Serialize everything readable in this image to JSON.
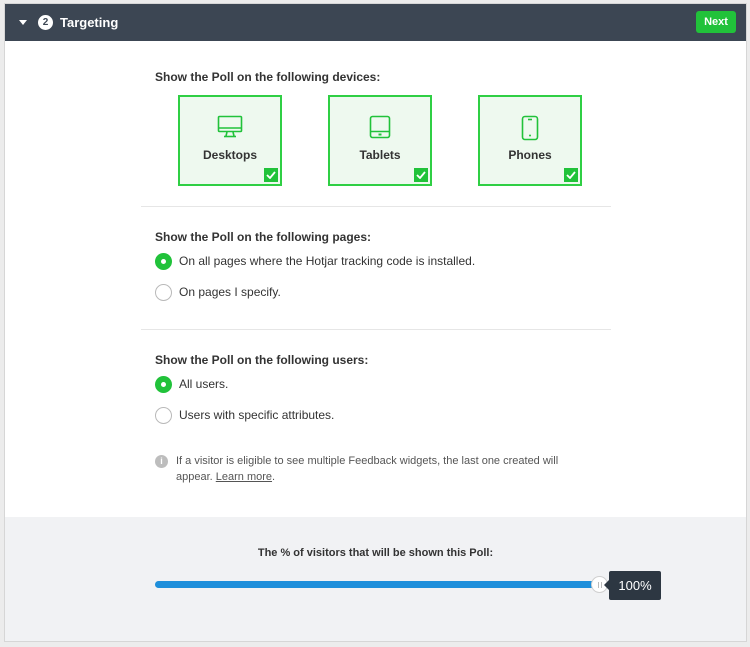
{
  "header": {
    "step_number": "2",
    "title": "Targeting",
    "next_label": "Next"
  },
  "devices": {
    "label": "Show the Poll on the following devices:",
    "items": [
      {
        "label": "Desktops",
        "icon": "desktop-icon",
        "checked": true
      },
      {
        "label": "Tablets",
        "icon": "tablet-icon",
        "checked": true
      },
      {
        "label": "Phones",
        "icon": "phone-icon",
        "checked": true
      }
    ]
  },
  "pages": {
    "label": "Show the Poll on the following pages:",
    "options": [
      {
        "label": "On all pages where the Hotjar tracking code is installed.",
        "checked": true
      },
      {
        "label": "On pages I specify.",
        "checked": false
      }
    ]
  },
  "users": {
    "label": "Show the Poll on the following users:",
    "options": [
      {
        "label": "All users.",
        "checked": true
      },
      {
        "label": "Users with specific attributes.",
        "checked": false
      }
    ]
  },
  "info": {
    "text": "If a visitor is eligible to see multiple Feedback widgets, the last one created will appear.",
    "link_text": "Learn more",
    "suffix": "."
  },
  "visitors": {
    "label": "The % of visitors that will be shown this Poll:",
    "percent": 100,
    "value_text": "100%"
  },
  "colors": {
    "accent_green": "#21c23a",
    "header_bg": "#3c4653",
    "slider_blue": "#1e8fdb"
  }
}
